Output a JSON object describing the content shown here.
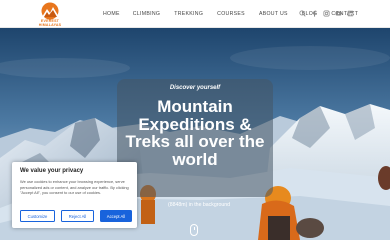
{
  "header": {
    "logo_text": "EVEREST HIMALAYAS",
    "nav": [
      "HOME",
      "CLIMBING",
      "TREKKING",
      "COURSES",
      "ABOUT US",
      "BLOG",
      "CONTACT"
    ],
    "icons": [
      "search-icon",
      "facebook-icon",
      "instagram-icon",
      "youtube-icon",
      "linkedin-icon"
    ]
  },
  "hero": {
    "kicker": "Discover yourself",
    "headline": "Mountain Expeditions & Treks all over the world",
    "caption": "(8848m) in the background"
  },
  "cookie": {
    "title": "We value your privacy",
    "text": "We use cookies to enhance your browsing experience, serve personalized ads or content, and analyze our traffic. By clicking \"Accept All\", you consent to our use of cookies.",
    "customize": "Customize",
    "reject": "Reject All",
    "accept": "Accept All"
  },
  "colors": {
    "accent": "#1863dc",
    "logo": "#e8761d"
  }
}
